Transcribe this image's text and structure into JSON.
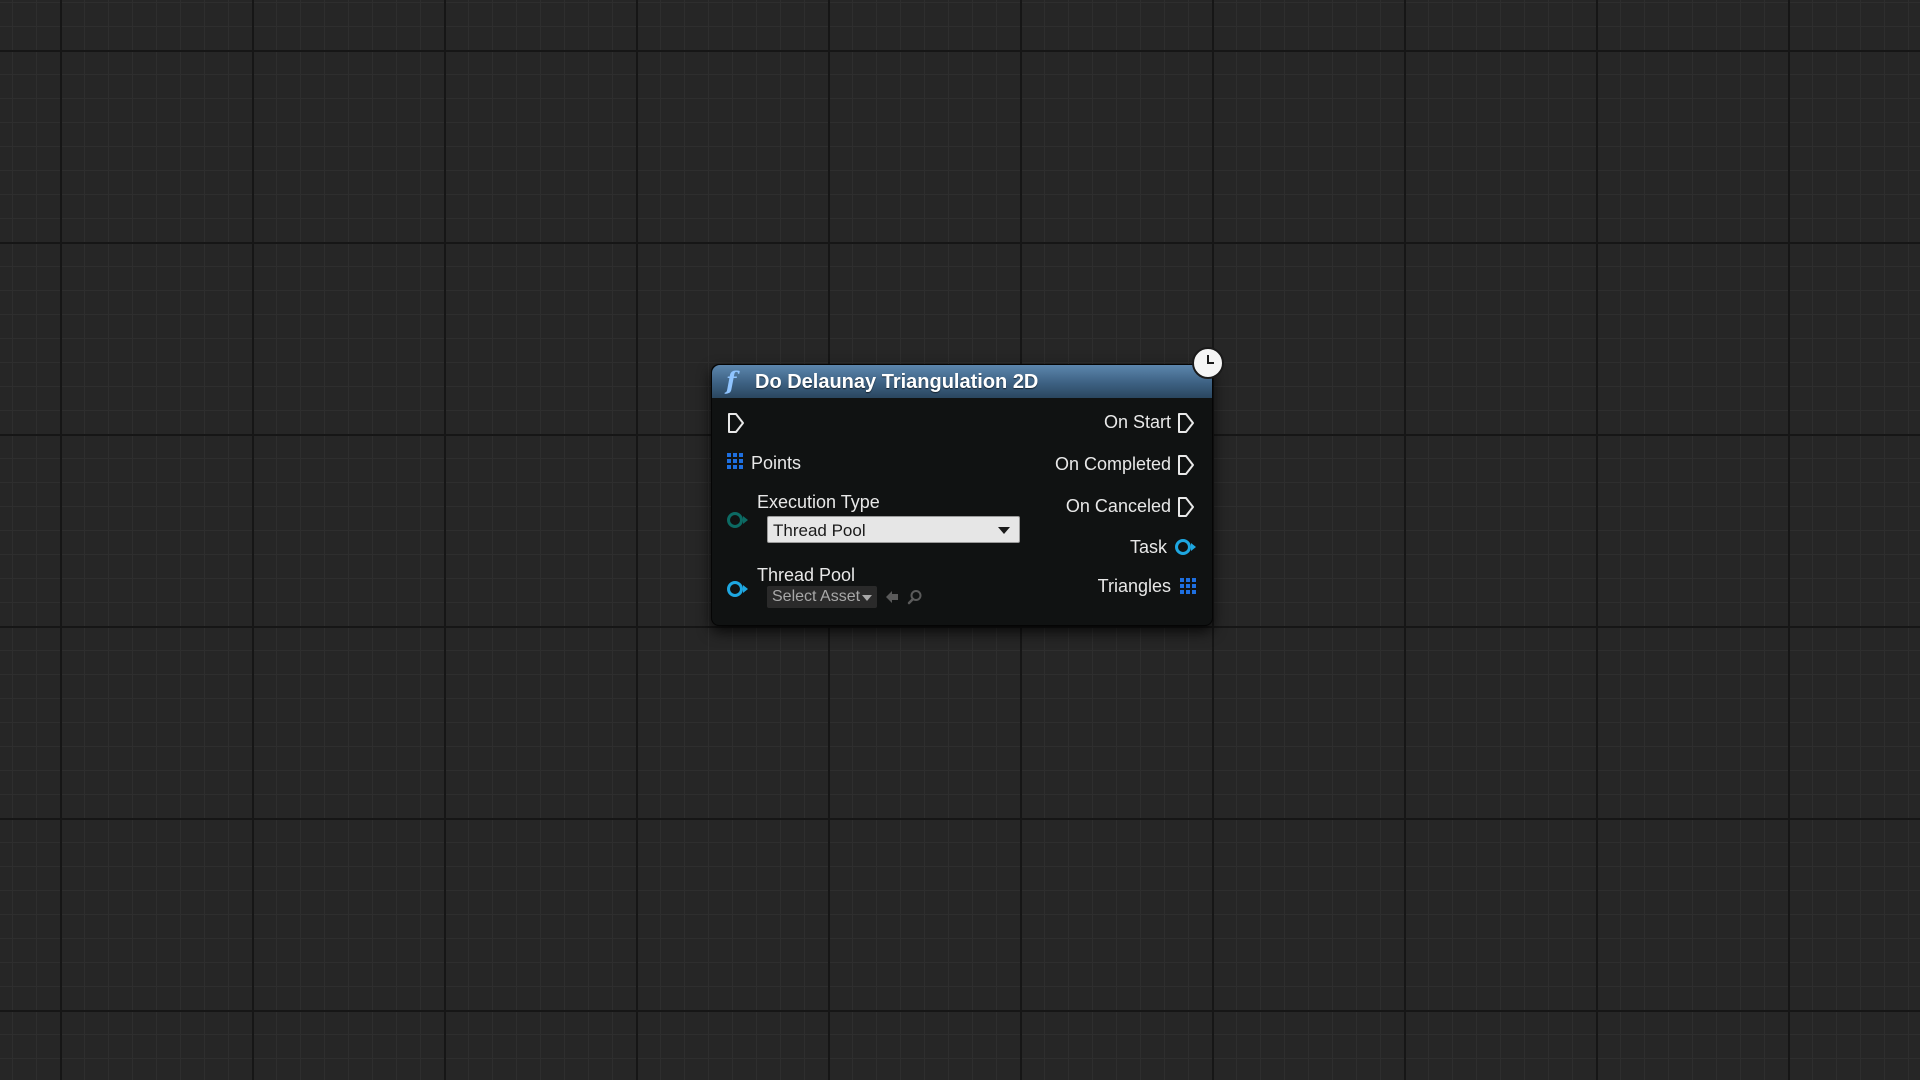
{
  "node": {
    "title": "Do Delaunay Triangulation 2D",
    "icons": {
      "function": "function-icon",
      "latent": "clock-icon",
      "exec": "exec-pin-icon",
      "array": "array-pin-icon",
      "object": "object-pin-icon"
    },
    "colors": {
      "header": "#3d6182",
      "function_icon": "#8fc4ff",
      "object_pin": "#1ea7e1",
      "enum_pin": "#0c6a63",
      "array_pin": "#1e6fe0"
    },
    "inputs": {
      "points_label": "Points",
      "execution_type_label": "Execution Type",
      "execution_type_value": "Thread Pool",
      "thread_pool_label": "Thread Pool",
      "thread_pool_placeholder": "Select Asset"
    },
    "outputs": {
      "on_start": "On Start",
      "on_completed": "On Completed",
      "on_canceled": "On Canceled",
      "task": "Task",
      "triangles": "Triangles"
    }
  }
}
